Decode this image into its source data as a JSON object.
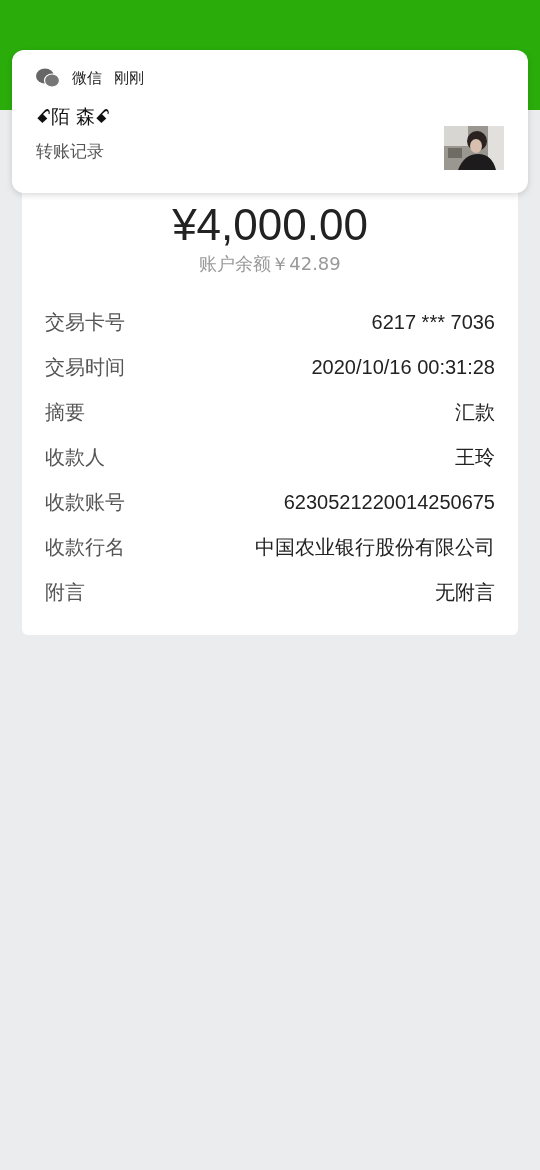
{
  "notification": {
    "app": "微信",
    "time": "刚刚",
    "sender": "ꗃ陌 森ꗃ",
    "message": "转账记录"
  },
  "receipt": {
    "amount": "¥4,000.00",
    "balance": "账户余额￥42.89",
    "details": [
      {
        "label": "交易卡号",
        "value": "6217 *** 7036"
      },
      {
        "label": "交易时间",
        "value": "2020/10/16 00:31:28"
      },
      {
        "label": "摘要",
        "value": "汇款"
      },
      {
        "label": "收款人",
        "value": "王玲"
      },
      {
        "label": "收款账号",
        "value": "6230521220014250675"
      },
      {
        "label": "收款行名",
        "value": "中国农业银行股份有限公司"
      },
      {
        "label": "附言",
        "value": "无附言"
      }
    ]
  }
}
